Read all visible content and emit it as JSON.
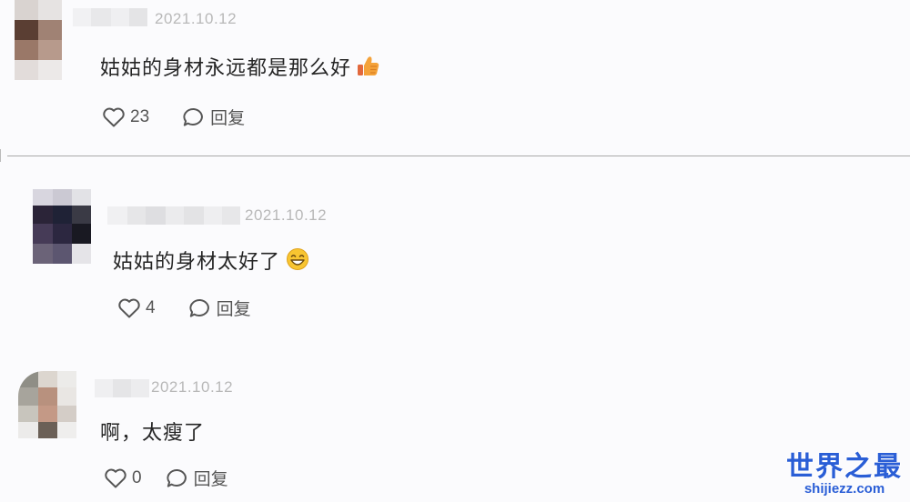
{
  "comments": [
    {
      "date": "2021.10.12",
      "text": "姑姑的身材永远都是那么好",
      "emoji": "thumbs-up-emoji",
      "likes": "23",
      "reply_label": "回复"
    },
    {
      "date": "2021.10.12",
      "text": "姑姑的身材太好了",
      "emoji": "grinning-face-emoji",
      "likes": "4",
      "reply_label": "回复"
    },
    {
      "date": "2021.10.12",
      "text": "啊，太瘦了",
      "likes": "0",
      "reply_label": "回复"
    }
  ],
  "watermark": {
    "title": "世界之最",
    "domain": "shijiezz.com"
  },
  "colors": {
    "background": "#fbfbfd",
    "date_text": "#b8b8b8",
    "watermark_blue": "#2a5ed6"
  }
}
